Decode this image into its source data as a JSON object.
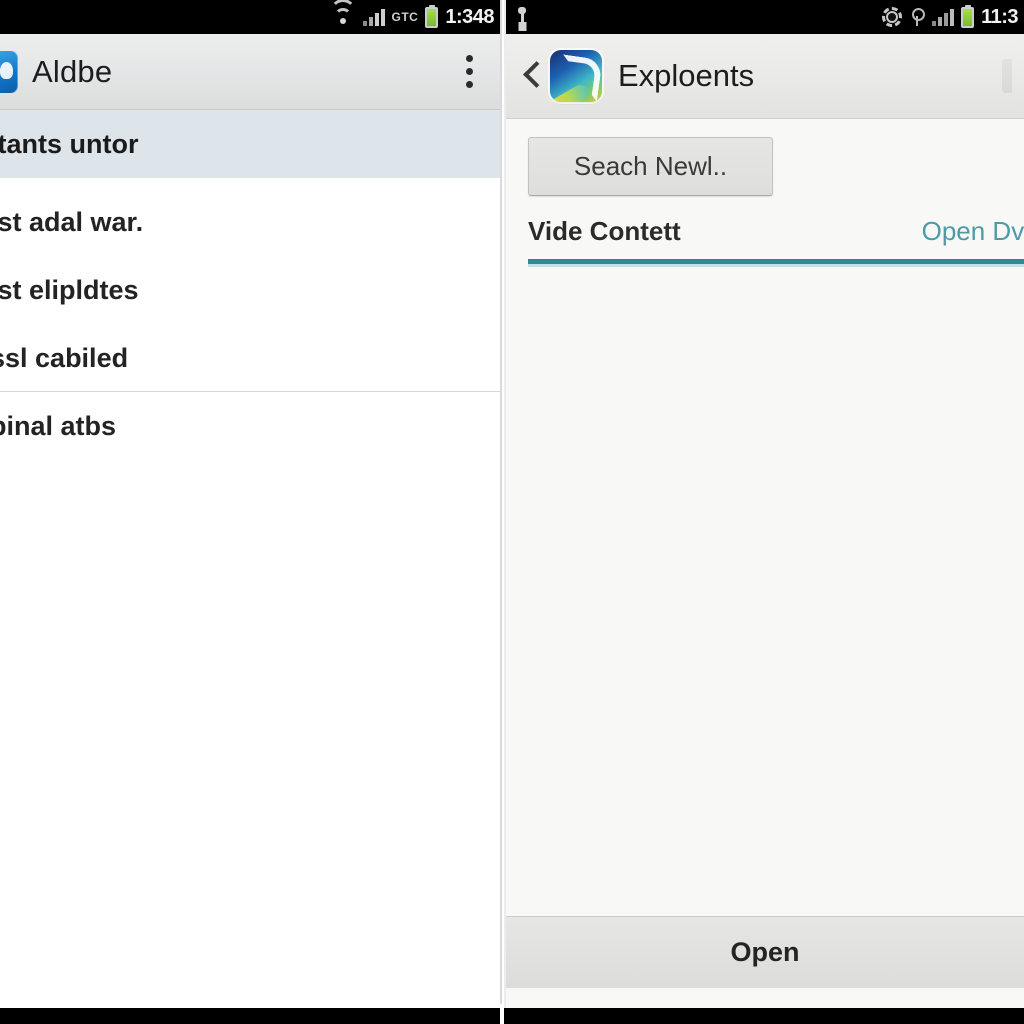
{
  "left_phone": {
    "status_bar": {
      "wifi_icon": "wifi-icon",
      "signal_icon": "signal-bars-icon",
      "network_label": "GTC",
      "battery_icon": "battery-icon",
      "time": "1:348"
    },
    "action_bar": {
      "app_icon": "app-icon",
      "title": "Aldbe",
      "overflow_icon": "overflow-menu-icon"
    },
    "list": [
      {
        "label": "Itants untor",
        "selected": true,
        "divider_below": false
      },
      {
        "label": "ist adal war.",
        "selected": false,
        "divider_below": false
      },
      {
        "label": "ist elipldtes",
        "selected": false,
        "divider_below": false
      },
      {
        "label": "ssl cabiled",
        "selected": false,
        "divider_below": true
      },
      {
        "label": "pinal atbs",
        "selected": false,
        "divider_below": false
      }
    ]
  },
  "right_phone": {
    "status_bar": {
      "usb_icon": "usb-icon",
      "gear_icon": "gear-icon",
      "key_icon": "key-icon",
      "signal_icon": "signal-bars-icon",
      "battery_icon": "battery-icon",
      "time": "11:3"
    },
    "action_bar": {
      "back_icon": "back-chevron-icon",
      "app_icon": "es-explorer-app-icon",
      "title": "Exploents",
      "action_icon": "search-action-icon"
    },
    "search_button": {
      "label": "Seach Newl.."
    },
    "tabs": {
      "active_label": "Vide Contett",
      "link_label": "Open Dvl",
      "underline_color": "#2f8a93"
    },
    "bottom_bar": {
      "open_label": "Open"
    }
  },
  "theme": {
    "selected_row_bg": "#dde4ea",
    "panel_bg": "#f8f8f6",
    "accent_teal": "#2f8a93",
    "link_teal": "#4f9aa6",
    "battery_green": "#8ec63f"
  }
}
